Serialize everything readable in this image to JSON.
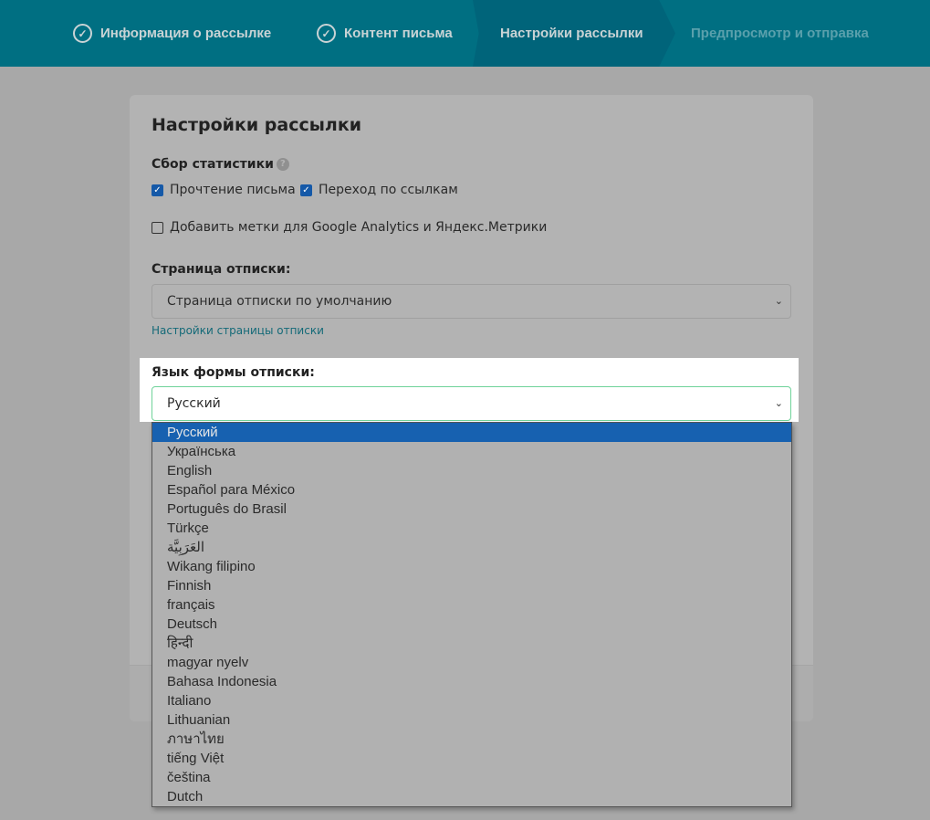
{
  "steps": [
    {
      "label": "Информация о рассылке",
      "state": "done"
    },
    {
      "label": "Контент письма",
      "state": "done"
    },
    {
      "label": "Настройки рассылки",
      "state": "active"
    },
    {
      "label": "Предпросмотр и отправка",
      "state": "future"
    }
  ],
  "card": {
    "title": "Настройки рассылки",
    "stats": {
      "label": "Сбор статистики",
      "help": "?",
      "read": {
        "label": "Прочтение письма",
        "checked": true
      },
      "clicks": {
        "label": "Переход по ссылкам",
        "checked": true
      },
      "utm": {
        "label": "Добавить метки для Google Analytics и Яндекс.Метрики",
        "checked": false
      }
    },
    "unsub": {
      "label": "Страница отписки:",
      "value": "Страница отписки по умолчанию",
      "link": "Настройки страницы отписки"
    },
    "lang": {
      "label": "Язык формы отписки:",
      "value": "Русский"
    }
  },
  "check": "✓",
  "caret": "⌄",
  "options": [
    "Русский",
    "Українська",
    "English",
    "Español para México",
    "Português do Brasil",
    "Türkçe",
    "العَرَبِيَّة",
    "Wikang filipino",
    "Finnish",
    "français",
    "Deutsch",
    "हिन्दी",
    "magyar nyelv",
    "Bahasa Indonesia",
    "Italiano",
    "Lithuanian",
    "ภาษาไทย",
    "tiếng Việt",
    "čeština",
    "Dutch"
  ],
  "selected_index": 0
}
